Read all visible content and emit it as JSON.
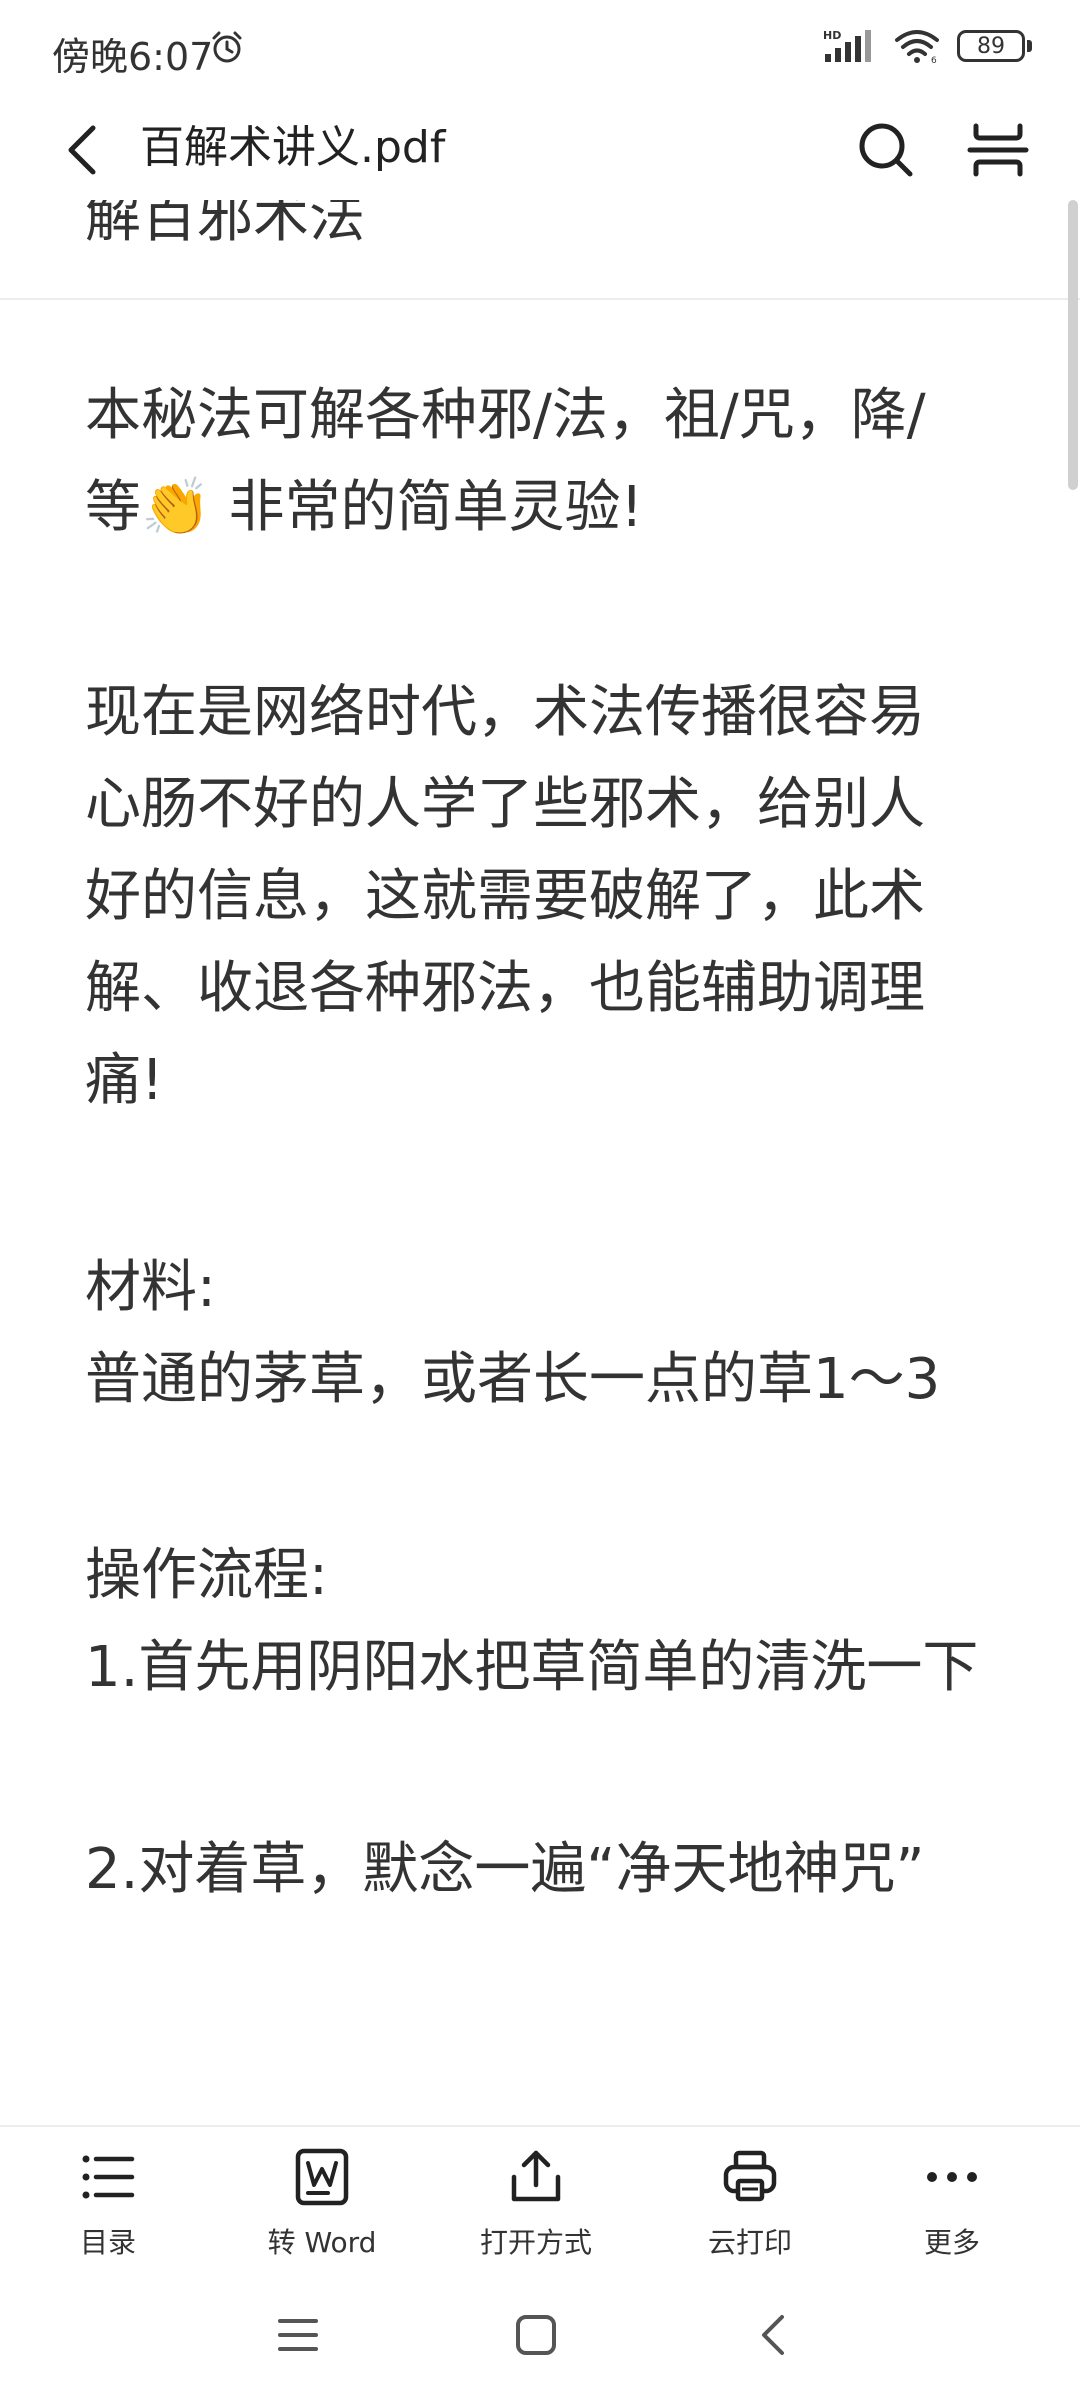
{
  "status_bar": {
    "time": "傍晚6:07",
    "battery": "89"
  },
  "header": {
    "title": "百解术讲义.pdf"
  },
  "document": {
    "lines": [
      "解百邪术法",
      "本秘法可解各种邪/法，祖/咒，降/",
      "等👏 非常的简单灵验!",
      "现在是网络时代，术法传播很容易",
      "心肠不好的人学了些邪术，给别人",
      "好的信息，这就需要破解了，此术",
      "解、收退各种邪法，也能辅助调理",
      "痛!",
      "材料:",
      "普通的茅草，或者长一点的草1～3",
      "操作流程:",
      "1.首先用阴阳水把草简单的清洗一下",
      "2.对着草，默念一遍“净天地神咒”"
    ]
  },
  "toolbar": {
    "toc_label": "目录",
    "word_label": "转 Word",
    "open_with_label": "打开方式",
    "cloud_print_label": "云打印",
    "more_label": "更多"
  }
}
